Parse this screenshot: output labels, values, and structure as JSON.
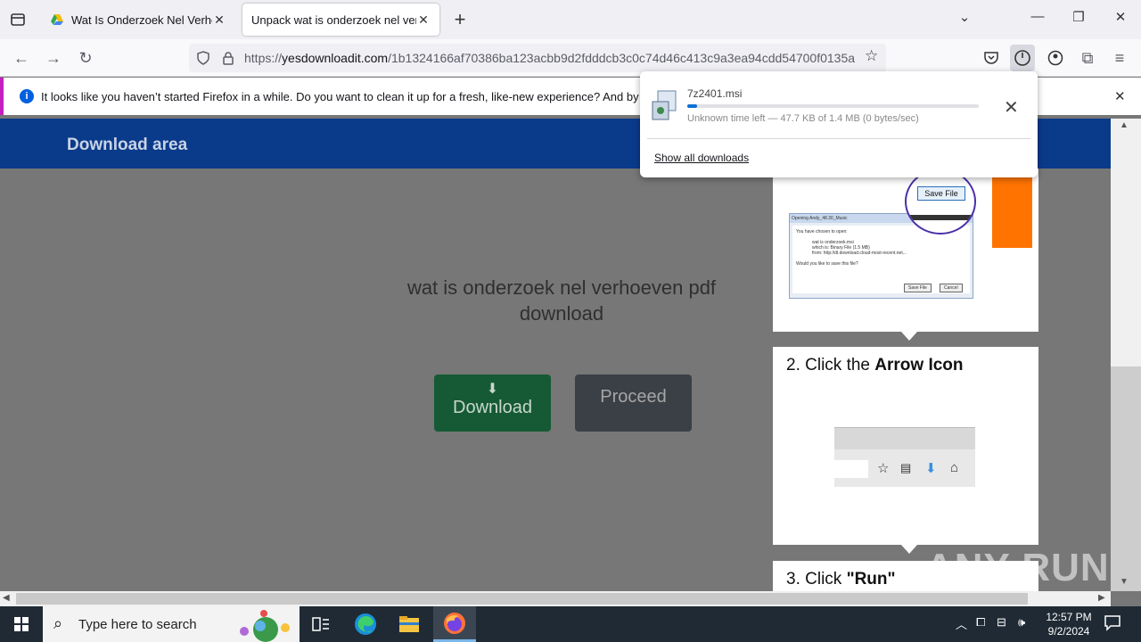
{
  "tabs": [
    {
      "title": "Wat Is Onderzoek Nel Verhoeven",
      "favicon": "google-drive-icon"
    },
    {
      "title": "Unpack wat is onderzoek nel verhoeven",
      "favicon": ""
    }
  ],
  "navbar": {
    "url_scheme": "https://",
    "url_host": "yesdownloadit.com",
    "url_path": "/1b1324166af70386ba123acbb9d2fdddcb3c0c74d46c413c9a3ea94cdd54700f0135a"
  },
  "notification": {
    "message": "It looks like you haven’t started Firefox in a while. Do you want to clean it up for a fresh, like-new experience? And by the way, welcome back!"
  },
  "page": {
    "header_title": "Download area",
    "heading": "wat is onderzoek nel verhoeven pdf download",
    "download_label": "Download",
    "proceed_label": "Proceed",
    "steps": [
      {
        "number": "2. Click the ",
        "bold": "Arrow Icon"
      },
      {
        "number": "3. Click ",
        "bold": "\"Run\""
      }
    ],
    "save_dialog": {
      "title": "Opening Andy_48.30_Music",
      "chosen": "You have chosen to open:",
      "filename": "wat is onderzoek.msi",
      "which_is": "which is: Binary File (1.5 MB)",
      "from": "from: http://dl.download.cloud-most-recent.net...",
      "question": "Would you like to save this file?",
      "save_label": "Save File",
      "cancel_label": "Cancel"
    }
  },
  "download_panel": {
    "filename": "7z2401.msi",
    "status": "Unknown time left — 47.7 KB of 1.4 MB (0 bytes/sec)",
    "progress": 0.034,
    "show_all": "Show all downloads"
  },
  "taskbar": {
    "search_placeholder": "Type here to search",
    "time": "12:57 PM",
    "date": "9/2/2024"
  },
  "watermark": "ANY RUN"
}
